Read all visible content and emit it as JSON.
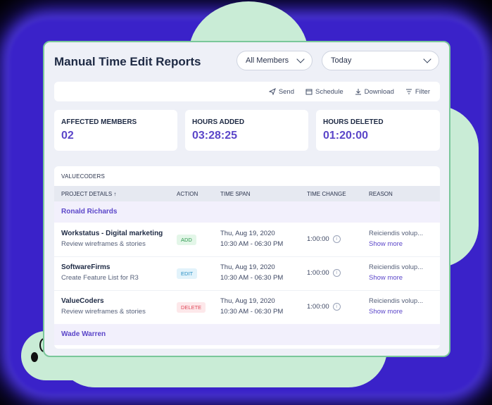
{
  "header": {
    "title": "Manual Time Edit Reports"
  },
  "filters": {
    "members": "All Members",
    "date": "Today"
  },
  "toolbar": {
    "send": "Send",
    "schedule": "Schedule",
    "download": "Download",
    "filter": "Filter"
  },
  "stats": [
    {
      "label": "AFFECTED MEMBERS",
      "value": "02"
    },
    {
      "label": "HOURS ADDED",
      "value": "03:28:25"
    },
    {
      "label": "HOURS DELETED",
      "value": "01:20:00"
    }
  ],
  "table": {
    "organization": "VALUECODERS",
    "columns": {
      "project": "PROJECT DETAILS ↑",
      "action": "ACTION",
      "span": "TIME SPAN",
      "change": "TIME CHANGE",
      "reason": "REASON"
    },
    "groups": [
      "Ronald Richards",
      "Wade Warren"
    ],
    "rows": [
      {
        "project": "Workstatus - Digital marketing",
        "task": "Review wireframes & stories",
        "action": "ADD",
        "date": "Thu, Aug 19, 2020",
        "time": "10:30 AM - 06:30 PM",
        "change": "1:00:00",
        "reason": "Reiciendis volup...",
        "more": "Show more"
      },
      {
        "project": "SoftwareFirms",
        "task": "Create Feature List for R3",
        "action": "EDIT",
        "date": "Thu, Aug 19, 2020",
        "time": "10:30 AM - 06:30 PM",
        "change": "1:00:00",
        "reason": "Reiciendis volup...",
        "more": "Show more"
      },
      {
        "project": "ValueCoders",
        "task": "Review wireframes & stories",
        "action": "DELETE",
        "date": "Thu, Aug 19, 2020",
        "time": "10:30 AM - 06:30 PM",
        "change": "1:00:00",
        "reason": "Reiciendis volup...",
        "more": "Show more"
      }
    ]
  },
  "colors": {
    "accent": "#5b46c9",
    "border": "#7ac79a",
    "glow": "#3a22c9"
  }
}
